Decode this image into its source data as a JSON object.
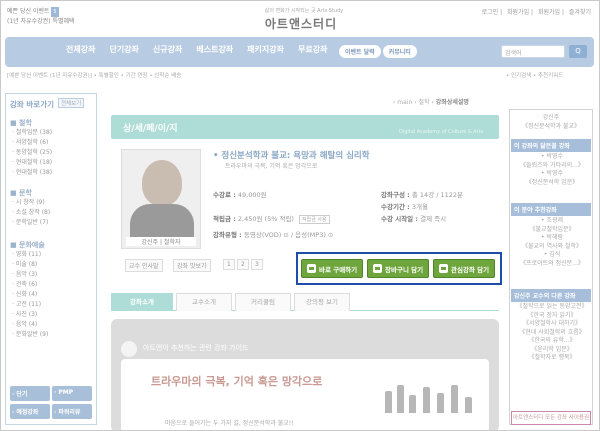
{
  "header": {
    "event_line1": "예쁜 당신 이벤트",
    "event_badge": "5",
    "event_line2": "(1년 자유수강권)",
    "event_tag": "특별혜택",
    "logo_sub": "삶의 변화가 시작되는 곳 Arts Study",
    "logo": "아트앤스터디",
    "top_links": [
      "로그인",
      "회원가입",
      "회원가입",
      "즐겨찾기"
    ]
  },
  "nav": {
    "items": [
      "전체강좌",
      "단기강좌",
      "신규강좌",
      "베스트강좌",
      "패키지강좌",
      "무료강좌"
    ],
    "pills": [
      "이벤트 달력",
      "커뮤니티"
    ],
    "search_placeholder": "검색어",
    "search_btn": "Q"
  },
  "subbar": {
    "left": "[예쁜 당신 이벤트 (1년 자유수강권)] • 특별할인 • 기간 연장 • 선착순 배송",
    "right": "• 인기검색  • 추천키워드"
  },
  "sidebar": {
    "title": "강좌 바로가기",
    "btn": "전체보기",
    "sections": [
      {
        "head": "■ 철학",
        "items": [
          "· 철학입문 (38)",
          "· 서양철학 (6)",
          "· 동양철학 (25)",
          "· 현대철학 (18)",
          "· 현대철학 (38)"
        ]
      },
      {
        "head": "■ 문학",
        "items": [
          "· 시 창작 (9)",
          "· 소설 창작 (8)",
          "· 문학일반 (7)"
        ]
      },
      {
        "head": "■ 문화예술",
        "items": [
          "· 영화 (11)",
          "· 미술 (8)",
          "· 음악 (3)",
          "· 건축 (6)",
          "· 신화 (4)",
          "· 고전 (11)",
          "· 사진 (3)",
          "· 음악 (4)",
          "· 문화일반 (9)"
        ]
      }
    ],
    "bottom1": [
      "· 단기",
      "· PMP"
    ],
    "bottom2": [
      "· 예정강좌",
      "· 파워리뷰"
    ]
  },
  "breadcrumb": {
    "path": "› main › 철학 › ",
    "current": "강좌상세설명"
  },
  "banner": {
    "title": "상/세/페/이/지",
    "sub": "Digital Academy of Culture & Arts"
  },
  "course": {
    "title": "• 정신분석학과 불교: 욕망과 해탈의 심리학",
    "subtitle": "트라우마의 극복, 기억 혹은 망각으로",
    "teacher": "강신주",
    "teacher_role": "철학자",
    "price_label": "수강료 :",
    "price": "49,000원",
    "reserve_label": "적립금 :",
    "reserve": "2,450원 (5% 적립)",
    "reserve_tag": "적립금 사용",
    "type_label": "강좌유형 :",
    "type": "동영상(VOD) ⊙ / 음성(MP3) ⊙",
    "comp_label": "강좌구성 :",
    "comp": "총 14강 / 1122분",
    "period_label": "수강기간 :",
    "period": "3개월",
    "start_label": "수강 시작일 :",
    "start": "결제 즉시",
    "btn_teacher": "교수 인사말",
    "btn_lecture": "강좌 맛보기",
    "pages": [
      "1",
      "2",
      "3"
    ]
  },
  "actions": {
    "buy": "바로 구매하기",
    "cart": "장바구니 담기",
    "wish": "관심강좌 담기"
  },
  "tabs": [
    "강좌소개",
    "교수소개",
    "커리큘럼",
    "강의평 보기"
  ],
  "guide": {
    "head": "아트앤이 추천하는 관련 강좌 가이드",
    "big": "트라우마의 극복, 기억 혹은 망각으로",
    "text": "마음으로 들어가는 두 가지 길, 정신분석학과 불교!!"
  },
  "right": {
    "teacher_lines": [
      "강신주",
      "《정신분석학과 불교》"
    ],
    "sec1": "이 강좌의 닮은꼴 강좌",
    "sec1_items": [
      "• 박영수",
      "《들뢰즈와 가타리의...》",
      "• 박영수",
      "《정신분석학 입문》"
    ],
    "sec2": "이 분야 추천강좌",
    "sec2_items": [
      "• 조광제",
      "《불교철학입문》",
      "• 박해람",
      "《불교의 역사와 철학》",
      "• 김석",
      "《프로이트와 정신분...》"
    ],
    "sec3": "강신주 교수의 다른 강좌",
    "sec3_items": [
      "《철학으로 읽는 동양고전》",
      "《한국 장자 읽기》",
      "《서양철학사 대하기》",
      "《현대 사회철학의 흐름》",
      "《한국의 유학...》",
      "《윤리학 입문》",
      "《철학자로 행복》"
    ],
    "bottom": "아트앤스터디 모든 강좌 사이용권"
  },
  "colors": {
    "accent_blue": "#1c4fa8",
    "nav": "#b7cbe2",
    "mint": "#aedcd6",
    "green_btn": "#6fa53d"
  }
}
